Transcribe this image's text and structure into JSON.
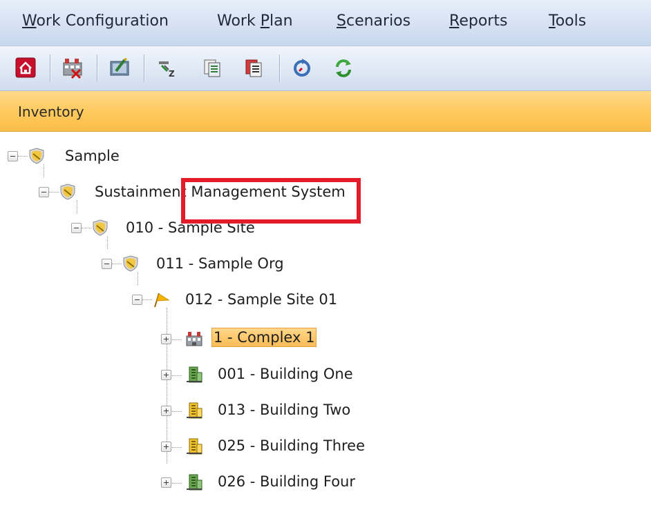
{
  "menu": {
    "items": [
      {
        "pre": "",
        "ul": "W",
        "post": "ork Configuration"
      },
      {
        "pre": "Work ",
        "ul": "P",
        "post": "lan"
      },
      {
        "pre": "",
        "ul": "S",
        "post": "cenarios"
      },
      {
        "pre": "",
        "ul": "R",
        "post": "eports"
      },
      {
        "pre": "",
        "ul": "T",
        "post": "ools"
      }
    ]
  },
  "toolbar": {
    "buttons": [
      "home-icon",
      "delete-complex-icon",
      "edit-record-icon",
      "sort-icon",
      "copy-icon",
      "paste-red-icon",
      "refresh-icon",
      "sync-icon"
    ]
  },
  "panel": {
    "title": "Inventory"
  },
  "tree": {
    "nodes": [
      {
        "label": "Sample",
        "icon": "shield-icon",
        "state": "expanded"
      },
      {
        "label": "Sustainment Management System",
        "icon": "shield-icon",
        "state": "expanded"
      },
      {
        "label": "010 - Sample Site",
        "icon": "shield-icon",
        "state": "expanded"
      },
      {
        "label": "011 - Sample Org",
        "icon": "shield-icon",
        "state": "expanded"
      },
      {
        "label": "012 - Sample Site 01",
        "icon": "flag-icon",
        "state": "expanded"
      },
      {
        "label": "1 - Complex 1",
        "icon": "complex-icon",
        "state": "collapsed",
        "selected": true
      },
      {
        "label": "001 - Building One",
        "icon": "building-green-icon",
        "state": "collapsed"
      },
      {
        "label": "013 - Building Two",
        "icon": "building-yellow-icon",
        "state": "collapsed"
      },
      {
        "label": "025 - Building Three",
        "icon": "building-yellow-icon",
        "state": "collapsed"
      },
      {
        "label": "026 - Building Four",
        "icon": "building-green-icon",
        "state": "collapsed"
      }
    ]
  },
  "colors": {
    "highlight": "#e31b2a",
    "selection": "#fbbd56",
    "header": "#ffc95c"
  }
}
